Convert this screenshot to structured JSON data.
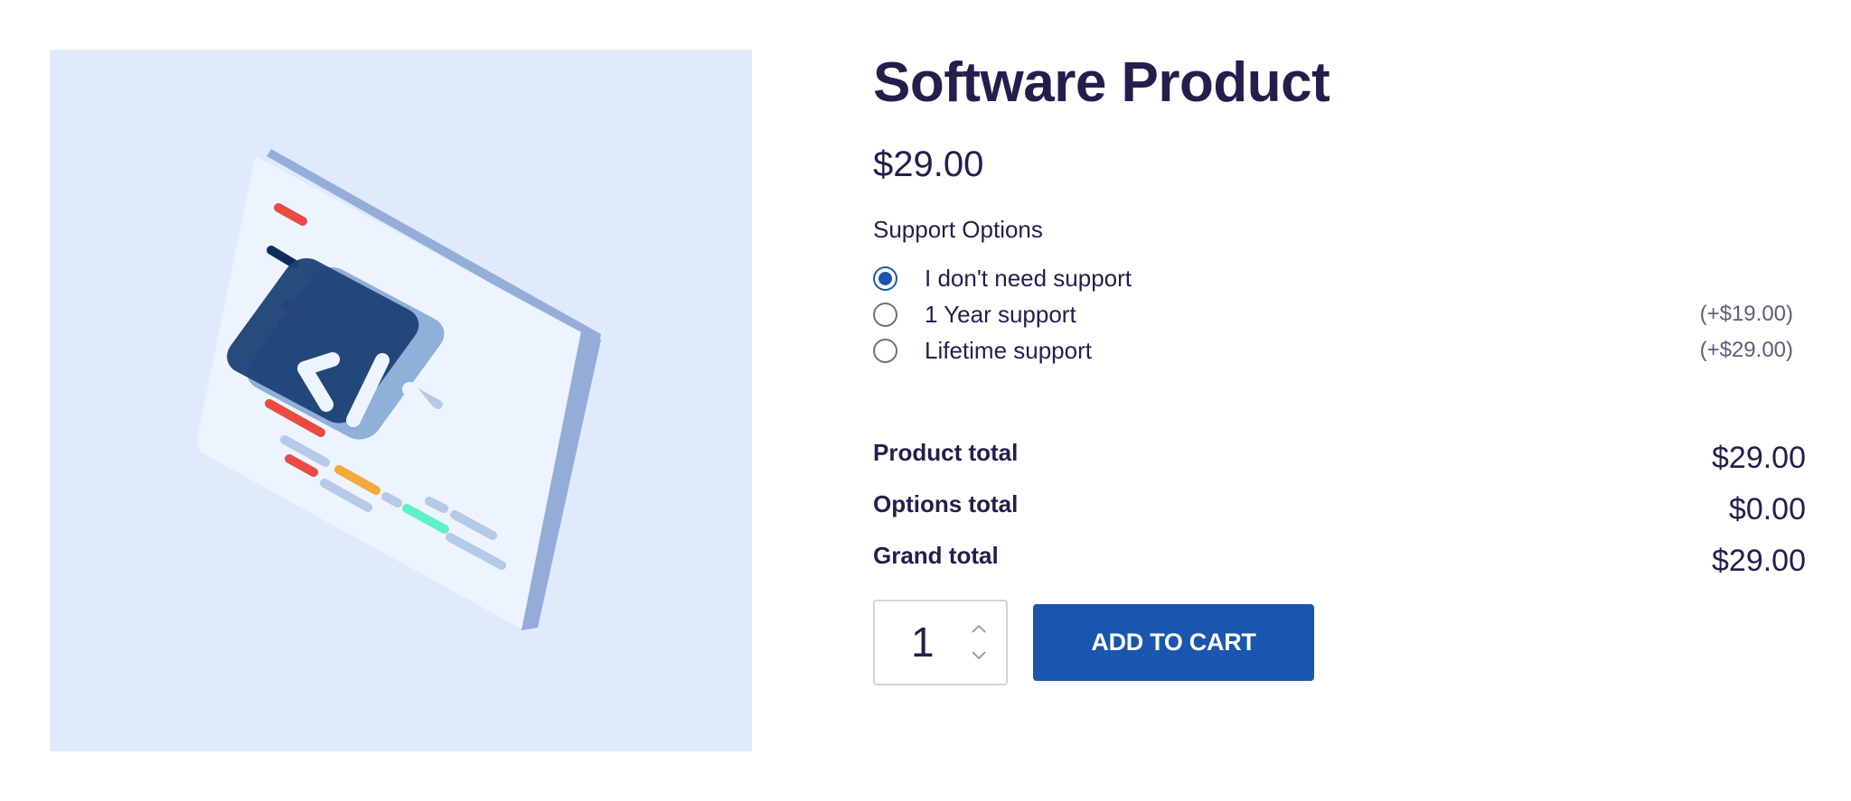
{
  "product": {
    "title": "Software Product",
    "price": "$29.00",
    "image_icon": "code-window-illustration"
  },
  "options": {
    "label": "Support Options",
    "items": [
      {
        "label": "I don't need support",
        "price": "",
        "selected": true
      },
      {
        "label": "1 Year support",
        "price": "(+$19.00)",
        "selected": false
      },
      {
        "label": "Lifetime support",
        "price": "(+$29.00)",
        "selected": false
      }
    ]
  },
  "totals": {
    "product_total_label": "Product total",
    "product_total_value": "$29.00",
    "options_total_label": "Options total",
    "options_total_value": "$0.00",
    "grand_total_label": "Grand total",
    "grand_total_value": "$29.00"
  },
  "cart": {
    "quantity": "1",
    "add_to_cart_label": "ADD TO CART"
  },
  "colors": {
    "accent": "#1a56ad",
    "text": "#221f4d",
    "image_background": "#dfebfc"
  }
}
